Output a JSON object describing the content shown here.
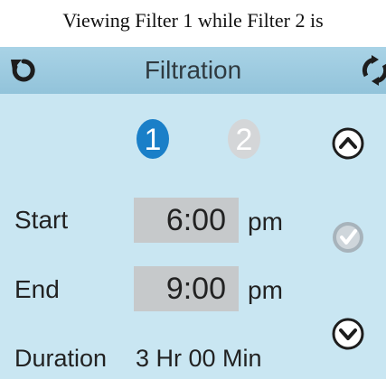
{
  "caption": "Viewing Filter 1 while Filter 2 is",
  "header": {
    "title": "Filtration",
    "back_icon": "back-icon",
    "refresh_icon": "refresh-icon"
  },
  "filters": {
    "filter1_label": "1",
    "filter2_label": "2",
    "active": "1",
    "active_color": "#1a7fc8",
    "inactive_color": "#d4d6d8"
  },
  "schedule": {
    "start_label": "Start",
    "start_time": "6:00",
    "start_ampm": "pm",
    "end_label": "End",
    "end_time": "9:00",
    "end_ampm": "pm",
    "duration_label": "Duration",
    "duration_value": "3 Hr 00 Min"
  },
  "side_buttons": {
    "up_icon": "chevron-up-icon",
    "confirm_icon": "checkmark-icon",
    "down_icon": "chevron-down-icon"
  },
  "colors": {
    "screen_bg": "#c9e6f2",
    "header_bg": "#9fcbe0",
    "timebox_bg": "#c6c9cb"
  }
}
